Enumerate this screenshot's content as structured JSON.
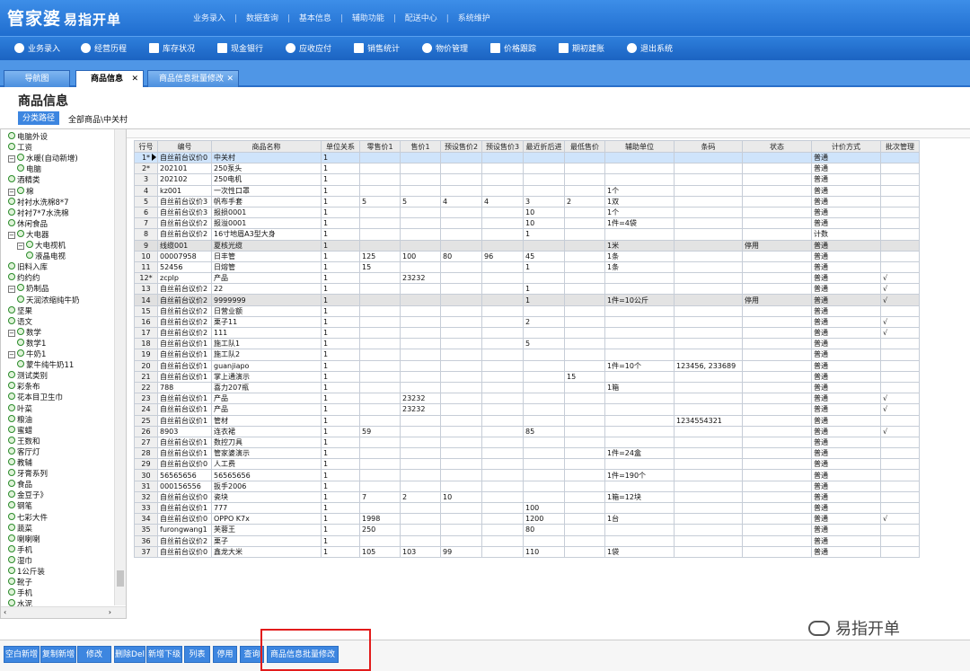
{
  "app": {
    "name": "管家婆",
    "subtitle": "易指开单"
  },
  "top_menu": [
    "业务录入",
    "数据查询",
    "基本信息",
    "辅助功能",
    "配送中心",
    "系统维护"
  ],
  "toolbar": [
    "业务录入",
    "经营历程",
    "库存状况",
    "现金银行",
    "应收应付",
    "销售统计",
    "物价管理",
    "价格跟踪",
    "期初建账",
    "退出系统"
  ],
  "tabs": [
    {
      "label": "导航图"
    },
    {
      "label": "商品信息"
    },
    {
      "label": "商品信息批量修改"
    }
  ],
  "page": {
    "title": "商品信息",
    "category_button": "分类路径",
    "category_path": "全部商品\\中关村"
  },
  "tree": [
    {
      "label": "电脑外设",
      "type": "node",
      "level": 0
    },
    {
      "label": "工资",
      "type": "node",
      "level": 0
    },
    {
      "label": "水暖(自动新增)",
      "type": "exp",
      "level": 0
    },
    {
      "label": "电脑",
      "type": "node",
      "level": 1
    },
    {
      "label": "酒精类",
      "type": "node",
      "level": 0
    },
    {
      "label": "棉",
      "type": "exp",
      "level": 0
    },
    {
      "label": "衬衬水洗棉8*7",
      "type": "node",
      "level": 0
    },
    {
      "label": "衬衬7*7水洗棉",
      "type": "node",
      "level": 0
    },
    {
      "label": "休闲食品",
      "type": "node",
      "level": 0
    },
    {
      "label": "大电器",
      "type": "exp",
      "level": 0
    },
    {
      "label": "大电视机",
      "type": "exp",
      "level": 1
    },
    {
      "label": "液晶电视",
      "type": "node",
      "level": 2
    },
    {
      "label": "旧料入库",
      "type": "node",
      "level": 0
    },
    {
      "label": "约约约",
      "type": "node",
      "level": 0
    },
    {
      "label": "奶制品",
      "type": "exp",
      "level": 0
    },
    {
      "label": "天润浓缩纯牛奶",
      "type": "node",
      "level": 1
    },
    {
      "label": "坚果",
      "type": "node",
      "level": 0
    },
    {
      "label": "语文",
      "type": "node",
      "level": 0
    },
    {
      "label": "数学",
      "type": "exp",
      "level": 0
    },
    {
      "label": "数学1",
      "type": "node",
      "level": 1
    },
    {
      "label": "牛奶1",
      "type": "exp",
      "level": 0
    },
    {
      "label": "蒙牛纯牛奶11",
      "type": "node",
      "level": 1
    },
    {
      "label": "测试类别",
      "type": "node",
      "level": 0
    },
    {
      "label": "彩条布",
      "type": "node",
      "level": 0
    },
    {
      "label": "花本目卫生巾",
      "type": "node",
      "level": 0
    },
    {
      "label": "叶菜",
      "type": "node",
      "level": 0
    },
    {
      "label": "粮油",
      "type": "node",
      "level": 0
    },
    {
      "label": "蜜蜡",
      "type": "node",
      "level": 0
    },
    {
      "label": "王数和",
      "type": "node",
      "level": 0
    },
    {
      "label": "客厅灯",
      "type": "node",
      "level": 0
    },
    {
      "label": "教辅",
      "type": "node",
      "level": 0
    },
    {
      "label": "牙膏系列",
      "type": "node",
      "level": 0
    },
    {
      "label": "食品",
      "type": "node",
      "level": 0
    },
    {
      "label": "金豆子》",
      "type": "node",
      "level": 0
    },
    {
      "label": "钢笔",
      "type": "node",
      "level": 0
    },
    {
      "label": "七彩大件",
      "type": "node",
      "level": 0
    },
    {
      "label": "蔬菜",
      "type": "node",
      "level": 0
    },
    {
      "label": "喇喇喇",
      "type": "node",
      "level": 0
    },
    {
      "label": "手机",
      "type": "node",
      "level": 0
    },
    {
      "label": "湿巾",
      "type": "node",
      "level": 0
    },
    {
      "label": "1公斤装",
      "type": "node",
      "level": 0
    },
    {
      "label": "靴子",
      "type": "node",
      "level": 0
    },
    {
      "label": "手机",
      "type": "node",
      "level": 0
    },
    {
      "label": "水泥",
      "type": "node",
      "level": 0
    }
  ],
  "grid": {
    "columns": [
      "行号",
      "编号",
      "商品名称",
      "单位关系",
      "零售价1",
      "售价1",
      "预设售价2",
      "预设售价3",
      "最近折后进",
      "最低售价",
      "辅助单位",
      "条码",
      "状态",
      "计价方式",
      "批次管理"
    ],
    "rows": [
      [
        "1*",
        "自丝前台议价0",
        "中关村",
        "1",
        "",
        "",
        "",
        "",
        "",
        "",
        "",
        "",
        "",
        "普通",
        ""
      ],
      [
        "2*",
        "202101",
        "250泵头",
        "1",
        "",
        "",
        "",
        "",
        "",
        "",
        "",
        "",
        "",
        "普通",
        ""
      ],
      [
        "3",
        "202102",
        "250电机",
        "1",
        "",
        "",
        "",
        "",
        "",
        "",
        "",
        "",
        "",
        "普通",
        ""
      ],
      [
        "4",
        "kz001",
        "一次性口罩",
        "1",
        "",
        "",
        "",
        "",
        "",
        "",
        "1个",
        "",
        "",
        "普通",
        ""
      ],
      [
        "5",
        "自丝前台议价3",
        "帆布手套",
        "1",
        "5",
        "5",
        "4",
        "4",
        "3",
        "2",
        "1双",
        "",
        "",
        "普通",
        ""
      ],
      [
        "6",
        "自丝前台议价3",
        "报损0001",
        "1",
        "",
        "",
        "",
        "",
        "10",
        "",
        "1个",
        "",
        "",
        "普通",
        ""
      ],
      [
        "7",
        "自丝前台议价2",
        "报溢0001",
        "1",
        "",
        "",
        "",
        "",
        "10",
        "",
        "1件=4袋",
        "",
        "",
        "普通",
        ""
      ],
      [
        "8",
        "自丝前台议价2",
        "16寸地眉A3型大身",
        "1",
        "",
        "",
        "",
        "",
        "1",
        "",
        "",
        "",
        "",
        "计数",
        ""
      ],
      [
        "9",
        "线缆001",
        "夏核光缆",
        "1",
        "",
        "",
        "",
        "",
        "",
        "",
        "1米",
        "",
        "停用",
        "普通",
        ""
      ],
      [
        "10",
        "00007958",
        "日丰管",
        "1",
        "125",
        "100",
        "80",
        "96",
        "45",
        "",
        "1条",
        "",
        "",
        "普通",
        ""
      ],
      [
        "11",
        "52456",
        "日熔管",
        "1",
        "15",
        "",
        "",
        "",
        "1",
        "",
        "1条",
        "",
        "",
        "普通",
        ""
      ],
      [
        "12*",
        "zcplp",
        "产品",
        "1",
        "",
        "23232",
        "",
        "",
        "",
        "",
        "",
        "",
        "",
        "普通",
        "√"
      ],
      [
        "13",
        "自丝前台议价2",
        "22",
        "1",
        "",
        "",
        "",
        "",
        "1",
        "",
        "",
        "",
        "",
        "普通",
        "√"
      ],
      [
        "14",
        "自丝前台议价2",
        "9999999",
        "1",
        "",
        "",
        "",
        "",
        "1",
        "",
        "1件=10公斤",
        "",
        "停用",
        "普通",
        "√"
      ],
      [
        "15",
        "自丝前台议价2",
        "日营业额",
        "1",
        "",
        "",
        "",
        "",
        "",
        "",
        "",
        "",
        "",
        "普通",
        ""
      ],
      [
        "16",
        "自丝前台议价2",
        "栗子11",
        "1",
        "",
        "",
        "",
        "",
        "2",
        "",
        "",
        "",
        "",
        "普通",
        "√"
      ],
      [
        "17",
        "自丝前台议价2",
        "111",
        "1",
        "",
        "",
        "",
        "",
        "",
        "",
        "",
        "",
        "",
        "普通",
        "√"
      ],
      [
        "18",
        "自丝前台议价1",
        "施工队1",
        "1",
        "",
        "",
        "",
        "",
        "5",
        "",
        "",
        "",
        "",
        "普通",
        ""
      ],
      [
        "19",
        "自丝前台议价1",
        "施工队2",
        "1",
        "",
        "",
        "",
        "",
        "",
        "",
        "",
        "",
        "",
        "普通",
        ""
      ],
      [
        "20",
        "自丝前台议价1",
        "guanjiapo",
        "1",
        "",
        "",
        "",
        "",
        "",
        "",
        "1件=10个",
        "123456, 233689",
        "",
        "普通",
        ""
      ],
      [
        "21",
        "自丝前台议价1",
        "掌上通演示",
        "1",
        "",
        "",
        "",
        "",
        "",
        "15",
        "",
        "",
        "",
        "普通",
        ""
      ],
      [
        "22",
        "788",
        "喜力207瓶",
        "1",
        "",
        "",
        "",
        "",
        "",
        "",
        "1箱",
        "",
        "",
        "普通",
        ""
      ],
      [
        "23",
        "自丝前台议价1",
        "产品",
        "1",
        "",
        "23232",
        "",
        "",
        "",
        "",
        "",
        "",
        "",
        "普通",
        "√"
      ],
      [
        "24",
        "自丝前台议价1",
        "产品",
        "1",
        "",
        "23232",
        "",
        "",
        "",
        "",
        "",
        "",
        "",
        "普通",
        "√"
      ],
      [
        "25",
        "自丝前台议价1",
        "管材",
        "1",
        "",
        "",
        "",
        "",
        "",
        "",
        "",
        "1234554321",
        "",
        "普通",
        ""
      ],
      [
        "26",
        "8903",
        "连衣裙",
        "1",
        "59",
        "",
        "",
        "",
        "85",
        "",
        "",
        "",
        "",
        "普通",
        "√"
      ],
      [
        "27",
        "自丝前台议价1",
        "数控刀具",
        "1",
        "",
        "",
        "",
        "",
        "",
        "",
        "",
        "",
        "",
        "普通",
        ""
      ],
      [
        "28",
        "自丝前台议价1",
        "管家婆演示",
        "1",
        "",
        "",
        "",
        "",
        "",
        "",
        "1件=24盒",
        "",
        "",
        "普通",
        ""
      ],
      [
        "29",
        "自丝前台议价0",
        "人工费",
        "1",
        "",
        "",
        "",
        "",
        "",
        "",
        "",
        "",
        "",
        "普通",
        ""
      ],
      [
        "30",
        "56565656",
        "56565656",
        "1",
        "",
        "",
        "",
        "",
        "",
        "",
        "1件=190个",
        "",
        "",
        "普通",
        ""
      ],
      [
        "31",
        "000156556",
        "扳手2006",
        "1",
        "",
        "",
        "",
        "",
        "",
        "",
        "",
        "",
        "",
        "普通",
        ""
      ],
      [
        "32",
        "自丝前台议价0",
        "瓷块",
        "1",
        "7",
        "2",
        "10",
        "",
        "",
        "",
        "1箱=12块",
        "",
        "",
        "普通",
        ""
      ],
      [
        "33",
        "自丝前台议价1",
        "777",
        "1",
        "",
        "",
        "",
        "",
        "100",
        "",
        "",
        "",
        "",
        "普通",
        ""
      ],
      [
        "34",
        "自丝前台议价0",
        "OPPO K7x",
        "1",
        "1998",
        "",
        "",
        "",
        "1200",
        "",
        "1台",
        "",
        "",
        "普通",
        "√"
      ],
      [
        "35",
        "furongwang1",
        "芙蓉王",
        "1",
        "250",
        "",
        "",
        "",
        "80",
        "",
        "",
        "",
        "",
        "普通",
        ""
      ],
      [
        "36",
        "自丝前台议价2",
        "栗子",
        "1",
        "",
        "",
        "",
        "",
        "",
        "",
        "",
        "",
        "",
        "普通",
        ""
      ],
      [
        "37",
        "自丝前台议价0",
        "鑫龙大米",
        "1",
        "105",
        "103",
        "99",
        "",
        "110",
        "",
        "1袋",
        "",
        "",
        "普通",
        ""
      ]
    ]
  },
  "bottom_buttons": [
    "空白新增",
    "复制新增",
    "修改",
    "删除Del",
    "新增下级",
    "列表",
    "停用",
    "查询",
    "商品信息批量修改"
  ],
  "watermark": "易指开单"
}
